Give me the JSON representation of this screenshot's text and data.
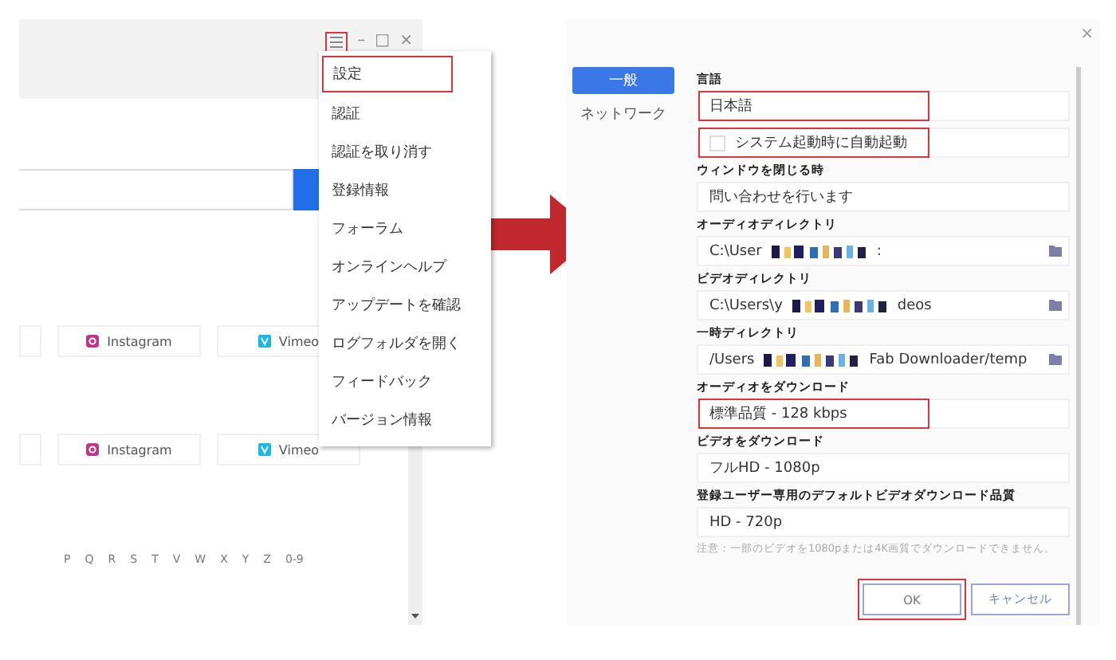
{
  "main_window": {
    "menu_button": {
      "highlighted": true
    },
    "window_controls": [
      "–",
      "□",
      "×"
    ],
    "social_rows": [
      [
        "Instagram",
        "Vimeo"
      ],
      [
        "Instagram",
        "Vimeo"
      ]
    ],
    "letters": [
      "P",
      "Q",
      "R",
      "S",
      "T",
      "V",
      "W",
      "X",
      "Y",
      "Z",
      "0-9"
    ],
    "menu": [
      {
        "label": "設定",
        "highlighted": true
      },
      {
        "label": "認証",
        "highlighted": false
      },
      {
        "label": "認証を取り消す",
        "highlighted": false
      },
      {
        "label": "登録情報",
        "highlighted": false
      },
      {
        "label": "フォーラム",
        "highlighted": false
      },
      {
        "label": "オンラインヘルプ",
        "highlighted": false
      },
      {
        "label": "アップデートを確認",
        "highlighted": false
      },
      {
        "label": "ログフォルダを開く",
        "highlighted": false
      },
      {
        "label": "フィードバック",
        "highlighted": false
      },
      {
        "label": "バージョン情報",
        "highlighted": false
      }
    ]
  },
  "settings_window": {
    "close": "×",
    "tabs": [
      {
        "label": "一般",
        "selected": true
      },
      {
        "label": "ネットワーク",
        "selected": false
      }
    ],
    "fields": [
      {
        "kind": "select",
        "label": "言語",
        "value": "日本語",
        "highlighted": true
      },
      {
        "kind": "checkbox",
        "value": "システム起動時に自動起動",
        "checked": false,
        "highlighted": true
      },
      {
        "kind": "select",
        "label": "ウィンドウを閉じる時",
        "value": "問い合わせを行います",
        "highlighted": false
      },
      {
        "kind": "path",
        "label": "オーディオディレクトリ",
        "prefix": "C:\\User",
        "suffix": ":",
        "highlighted": false
      },
      {
        "kind": "path",
        "label": "ビデオディレクトリ",
        "prefix": "C:\\Users\\y",
        "suffix": "deos",
        "highlighted": false
      },
      {
        "kind": "path",
        "label": "一時ディレクトリ",
        "prefix": "/Users",
        "suffix": "Fab Downloader/temp",
        "highlighted": false
      },
      {
        "kind": "select",
        "label": "オーディオをダウンロード",
        "value": "標準品質 - 128 kbps",
        "highlighted": true
      },
      {
        "kind": "select",
        "label": "ビデオをダウンロード",
        "value": "フルHD - 1080p",
        "highlighted": false
      },
      {
        "kind": "select",
        "label": "登録ユーザー専用のデフォルトビデオダウンロード品質",
        "value": "HD - 720p",
        "highlighted": false
      }
    ],
    "note": "注意：一部のビデオを1080pまたは4K画質でダウンロードできません。",
    "buttons": [
      {
        "label": "OK",
        "highlighted": true
      },
      {
        "label": "キャンセル",
        "highlighted": false
      }
    ]
  }
}
